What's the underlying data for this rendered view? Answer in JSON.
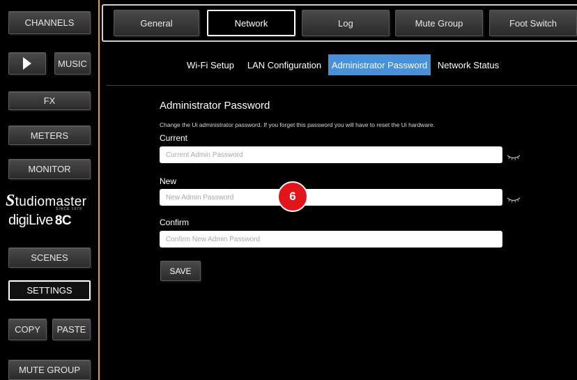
{
  "sidebar": {
    "channels": "CHANNELS",
    "music": "MUSIC",
    "fx": "FX",
    "meters": "METERS",
    "monitor": "MONITOR",
    "scenes": "SCENES",
    "settings": "SETTINGS",
    "copy": "COPY",
    "paste": "PASTE",
    "mute_group": "MUTE GROUP"
  },
  "logo": {
    "brand_initial": "S",
    "brand_rest": "tudiomaster",
    "since": "SINCE 1979",
    "product": "digiLive",
    "product_model": "8C"
  },
  "top_tabs": [
    "General",
    "Network",
    "Log",
    "Mute Group",
    "Foot Switch"
  ],
  "sub_tabs": [
    "Wi-Fi Setup",
    "LAN Configuration",
    "Administrator Password",
    "Network Status"
  ],
  "form": {
    "title": "Administrator Password",
    "description": "Change the Ui administrator password. If you forget this password you will have to reset the Ui hardware.",
    "current_label": "Current",
    "current_placeholder": "Current Admin Password",
    "new_label": "New",
    "new_placeholder": "New Admin Password",
    "confirm_label": "Confirm",
    "confirm_placeholder": "Confirm New Admin Password",
    "save_label": "SAVE"
  },
  "step_marker": "6",
  "colors": {
    "accent_orange": "#f0a020",
    "active_subtab": "#4a90d9",
    "marker_red": "#e4141b"
  }
}
